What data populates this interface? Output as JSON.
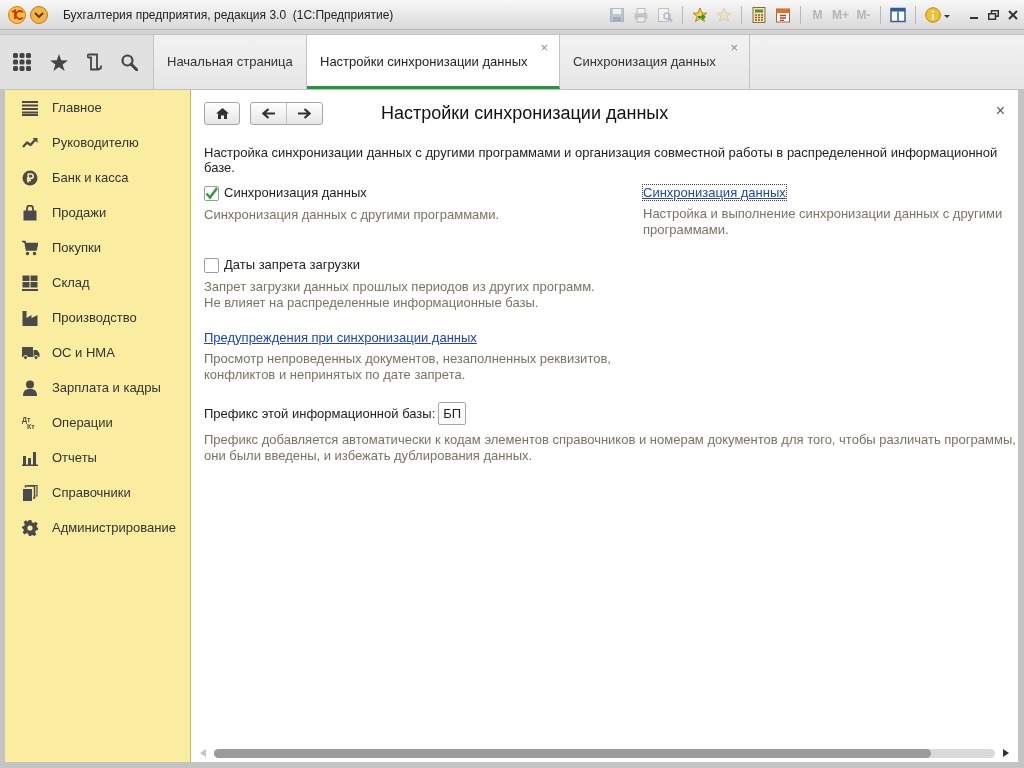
{
  "window": {
    "title": "Бухгалтерия предприятия, редакция 3.0  (1С:Предприятие)",
    "tool_groups": [
      [
        {
          "kind": "icon",
          "disabled": true
        },
        {
          "kind": "icon",
          "disabled": true
        },
        {
          "kind": "icon",
          "disabled": true
        }
      ],
      [
        {
          "kind": "icon",
          "disabled": false
        },
        {
          "kind": "icon",
          "disabled": true
        }
      ],
      [
        {
          "kind": "icon",
          "disabled": false
        },
        {
          "kind": "icon",
          "disabled": false
        }
      ],
      [
        {
          "kind": "text",
          "label": "M",
          "disabled": true
        },
        {
          "kind": "text",
          "label": "M+",
          "disabled": true
        },
        {
          "kind": "text",
          "label": "M-",
          "disabled": true
        }
      ],
      [
        {
          "kind": "icon",
          "disabled": false
        }
      ],
      [
        {
          "kind": "icon",
          "disabled": false
        }
      ]
    ]
  },
  "tabs": [
    {
      "label": "Начальная страница",
      "selected": false
    },
    {
      "label": "Настройки синхронизации данных",
      "selected": true,
      "close": "×"
    },
    {
      "label": "Синхронизация данных",
      "selected": false,
      "close": "×"
    }
  ],
  "sidebar": {
    "items": [
      {
        "label": "Главное",
        "selected": false
      },
      {
        "label": "Руководителю",
        "selected": false
      },
      {
        "label": "Банк и касса",
        "selected": false
      },
      {
        "label": "Продажи",
        "selected": false
      },
      {
        "label": "Покупки",
        "selected": false
      },
      {
        "label": "Склад",
        "selected": false
      },
      {
        "label": "Производство",
        "selected": false
      },
      {
        "label": "ОС и НМА",
        "selected": false
      },
      {
        "label": "Зарплата и кадры",
        "selected": false
      },
      {
        "label": "Операции",
        "selected": false,
        "glyph": [
          "Дт",
          "Кт"
        ]
      },
      {
        "label": "Отчеты",
        "selected": false
      },
      {
        "label": "Справочники",
        "selected": false
      },
      {
        "label": "Администрирование",
        "selected": false
      }
    ]
  },
  "form": {
    "title": "Настройки синхронизации данных",
    "close": "×",
    "description": "Настройка синхронизации данных с другими программами и организация совместной работы в распределенной информационной\nбазе.",
    "rows": [
      [
        {
          "kind": "checkbox",
          "label": "Синхронизация данных",
          "checked": true,
          "note": "Синхронизация данных с другими программами."
        },
        {
          "kind": "link",
          "label": "Синхронизация данных",
          "focused": true,
          "note": "Настройка и выполнение синхронизации данных с другими\nпрограммами."
        }
      ],
      [
        {
          "kind": "checkbox",
          "label": "Даты запрета загрузки",
          "checked": false,
          "note": "Запрет загрузки данных прошлых периодов из других программ.\nНе влияет на распределенные информационные базы."
        }
      ],
      [
        {
          "kind": "link",
          "label": "Предупреждения при синхронизации данных",
          "focused": false,
          "note": "Просмотр непроведенных документов, незаполненных реквизитов,\nконфликтов и непринятых по дате запрета."
        }
      ],
      [
        {
          "kind": "field",
          "label": "Префикс этой информационной базы:",
          "value": "БП",
          "note": "Префикс добавляется автоматически к кодам элементов справочников и номерам документов для того, чтобы различать программы,\nони были введены, и избежать дублирования данных."
        }
      ]
    ]
  }
}
